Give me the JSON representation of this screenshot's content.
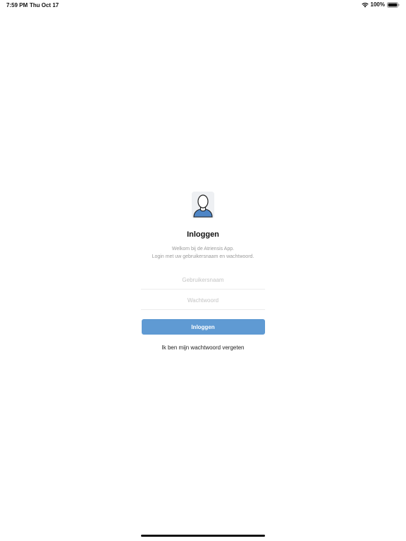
{
  "status_bar": {
    "time": "7:59 PM",
    "date": "Thu Oct 17",
    "battery": "100%",
    "wifi_icon": "wifi-icon",
    "battery_icon": "battery-icon"
  },
  "login": {
    "avatar_icon": "user-avatar-icon",
    "title": "Inloggen",
    "subtitle_line1": "Welkom bij de Atriensis App.",
    "subtitle_line2": "Login met uw gebruikersnaam en wachtwoord.",
    "username": {
      "value": "",
      "placeholder": "Gebruikersnaam"
    },
    "password": {
      "value": "",
      "placeholder": "Wachtwoord"
    },
    "submit_label": "Inloggen",
    "forgot_label": "Ik ben mijn wachtwoord vergeten"
  },
  "colors": {
    "accent": "#5f9ad3",
    "avatar_body": "#4f86c6"
  }
}
